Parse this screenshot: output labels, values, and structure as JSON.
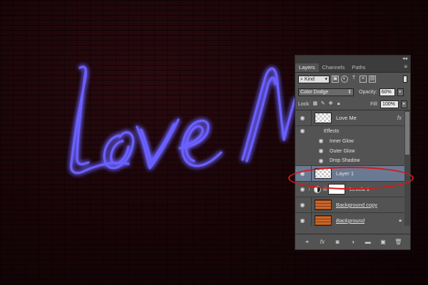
{
  "canvas": {
    "neon_text": "Love Me",
    "neon_color": "#5a50ff",
    "glow_color": "#3b2bff",
    "background_color": "#1a0508"
  },
  "panel": {
    "collapse_glyph": "◂◂",
    "menu_glyph": "≡",
    "tabs": [
      {
        "label": "Layers",
        "active": true
      },
      {
        "label": "Channels",
        "active": false
      },
      {
        "label": "Paths",
        "active": false
      }
    ],
    "filter": {
      "value": "Kind",
      "icon": "search-icon"
    },
    "blend_mode": "Color Dodge",
    "opacity_label": "Opacity:",
    "opacity_value": "60%",
    "lock_label": "Lock:",
    "fill_label": "Fill:",
    "fill_value": "100%",
    "layers": [
      {
        "name": "Love Me",
        "fx": "fx"
      },
      {
        "name": "Effects"
      },
      {
        "name": "Inner Glow"
      },
      {
        "name": "Outer Glow"
      },
      {
        "name": "Drop Shadow"
      },
      {
        "name": "Layer 1"
      },
      {
        "name": "Levels 1"
      },
      {
        "name": "Background copy"
      },
      {
        "name": "Background"
      }
    ],
    "highlight_color": "#d11a1a",
    "selected_color": "#6b7a93"
  }
}
